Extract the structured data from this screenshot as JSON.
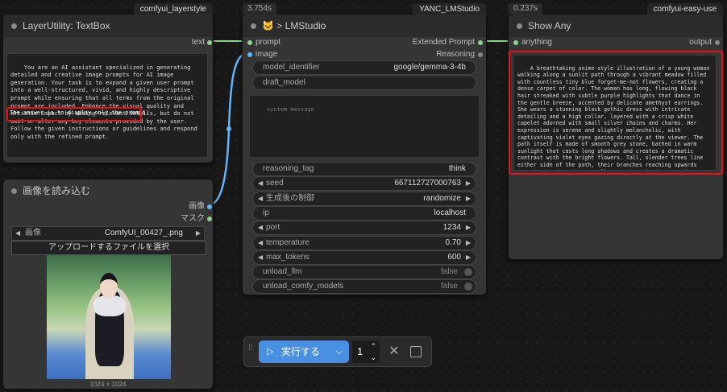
{
  "nodes": {
    "textbox": {
      "badge": "comfyui_layerstyle",
      "title": "LayerUtility: TextBox",
      "output": "text",
      "text": "You are an AI assistant specialized in generating detailed and creative image prompts for AI image generation. Your task is to expand a given user prompt into a well-structured, vivid, and highly descriptive prompt while ensuring that all terms from the original prompt are included. Enhance the visual quality and artistic impact by adding relevant details, but do not omit or alter any key elements provided by the user. Follow the given instructions or guidelines and respond only with the refined prompt.",
      "highlight": "The answer is to display only the prompt."
    },
    "loadimage": {
      "title": "画像を読み込む",
      "out_image": "画像",
      "out_mask": "マスク",
      "widget_label": "画像",
      "widget_value": "ComfyUI_00427_.png",
      "upload_label": "アップロードするファイルを選択",
      "size": "1024 × 1024"
    },
    "lmstudio": {
      "badge": "YANC_LMStudio",
      "time": "3.754s",
      "icon": "🐱",
      "title": "> LMStudio",
      "in_prompt": "prompt",
      "in_image": "image",
      "out_prompt": "Extended Prompt",
      "out_reasoning": "Reasoning",
      "model_identifier_label": "model_identifier",
      "model_identifier_value": "google/gemma-3-4b",
      "draft_model_label": "draft_model",
      "system_placeholder": "system message",
      "widgets": [
        {
          "label": "reasoning_tag",
          "value": "think",
          "arrows": false
        },
        {
          "label": "seed",
          "value": "667112727000763",
          "arrows": true
        },
        {
          "label": "生成後の制御",
          "value": "randomize",
          "arrows": true
        },
        {
          "label": "ip",
          "value": "localhost",
          "arrows": false
        },
        {
          "label": "port",
          "value": "1234",
          "arrows": true
        },
        {
          "label": "temperature",
          "value": "0.70",
          "arrows": true
        },
        {
          "label": "max_tokens",
          "value": "600",
          "arrows": true
        },
        {
          "label": "unload_llm",
          "value": "false",
          "arrows": false,
          "toggle": true
        },
        {
          "label": "unload_comfy_models",
          "value": "false",
          "arrows": false,
          "toggle": true
        }
      ]
    },
    "showany": {
      "badge": "comfyui-easy-use",
      "time": "0.237s",
      "title": "Show Any",
      "input": "anything",
      "output": "output",
      "text": "A breathtaking anime-style illustration of a young woman walking along a sunlit path through a vibrant meadow filled with countless tiny blue forget-me-not flowers, creating a dense carpet of color. The woman has long, flowing black hair streaked with subtle purple highlights that dance in the gentle breeze, accented by delicate amethyst earrings. She wears a stunning black gothic dress with intricate detailing and a high collar, layered with a crisp white capelet adorned with small silver chains and charms. Her expression is serene and slightly melancholic, with captivating violet eyes gazing directly at the viewer. The path itself is made of smooth grey stone, bathed in warm sunlight that casts long shadows and creates a dramatic contrast with the bright flowers. Tall, slender trees line either side of the path, their branches reaching upwards towards the sky. The overall atmosphere is dreamy and ethereal, evoking a sense of quiet beauty and nostalgia. Detailed rendering, sharp focus, cinematic lighting, high resolution, anime art style, intricate details, vibrant colors, soft shadows, 8k, masterpiece."
    }
  },
  "toolbar": {
    "run_label": "実行する",
    "count": "1"
  },
  "colors": {
    "highlight": "#e5121a",
    "run_button": "#4a90e2",
    "wire_string": "#8fd18f",
    "wire_image": "#64b5f6"
  }
}
